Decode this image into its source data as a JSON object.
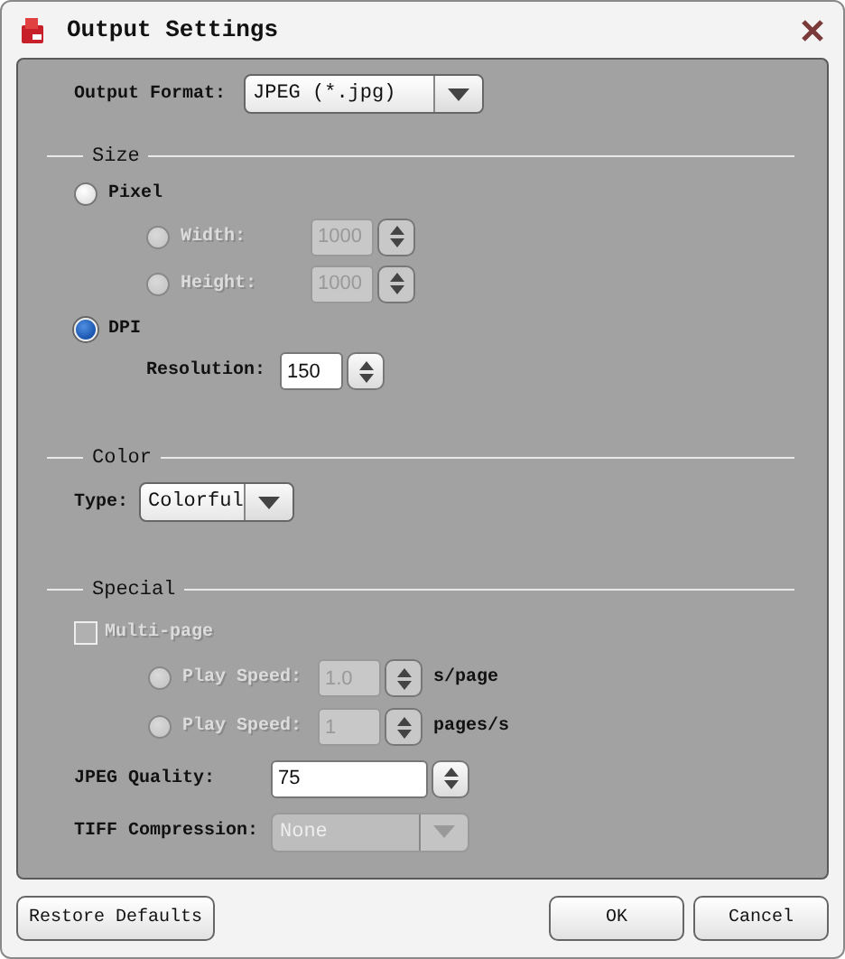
{
  "window": {
    "title": "Output Settings"
  },
  "output_format": {
    "label": "Output Format:",
    "value": "JPEG (*.jpg)"
  },
  "size": {
    "title": "Size",
    "modes": [
      {
        "label": "Pixel",
        "selected": false,
        "fields": [
          {
            "kind": "radio",
            "label": "Width:",
            "value": "1000",
            "selected": false,
            "disabled": true
          },
          {
            "kind": "radio",
            "label": "Height:",
            "value": "1000",
            "selected": false,
            "disabled": true
          }
        ]
      },
      {
        "label": "DPI",
        "selected": true,
        "fields": [
          {
            "kind": "plain",
            "label": "Resolution:",
            "value": "150"
          }
        ]
      }
    ]
  },
  "color": {
    "title": "Color",
    "type_label": "Type:",
    "type_value": "Colorful"
  },
  "special": {
    "title": "Special",
    "multi_page": {
      "label": "Multi-page",
      "checked": false,
      "disabled": true
    },
    "play_speeds": [
      {
        "label": "Play Speed:",
        "value": "1.0",
        "unit": "s/page",
        "selected": false,
        "disabled": true
      },
      {
        "label": "Play Speed:",
        "value": "1",
        "unit": "pages/s",
        "selected": false,
        "disabled": true
      }
    ],
    "jpeg_quality": {
      "label": "JPEG Quality:",
      "value": "75"
    },
    "tiff_compression": {
      "label": "TIFF Compression:",
      "value": "None",
      "disabled": true
    }
  },
  "buttons": [
    {
      "label": "Restore Defaults"
    },
    {
      "label": "OK"
    },
    {
      "label": "Cancel"
    }
  ]
}
